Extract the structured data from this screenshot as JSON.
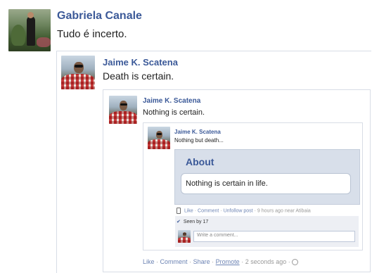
{
  "post": {
    "author": "Gabriela Canale",
    "text": "Tudo é incerto."
  },
  "level1": {
    "author": "Jaime K. Scatena",
    "text": "Death is certain."
  },
  "level2": {
    "author": "Jaime K. Scatena",
    "text": "Nothing is certain.",
    "actions": {
      "like": "Like",
      "comment": "Comment",
      "share": "Share",
      "promote": "Promote",
      "time": "2 seconds ago"
    },
    "separator": "·"
  },
  "level3": {
    "author": "Jaime K. Scatena",
    "text": "Nothing but death...",
    "about": {
      "title": "About",
      "text": "Nothing is certain in life."
    },
    "actions": {
      "like": "Like",
      "comment": "Comment",
      "unfollow": "Unfollow post",
      "time": "9 hours ago",
      "location": "near Atibaia"
    },
    "seen_by": "Seen by 17",
    "comment_placeholder": "Write a comment..."
  },
  "colors": {
    "name_blue": "#3b5998",
    "link_blue": "#6d84b4"
  },
  "icons": [
    "mobile-icon",
    "checkmark-icon",
    "globe-icon"
  ]
}
